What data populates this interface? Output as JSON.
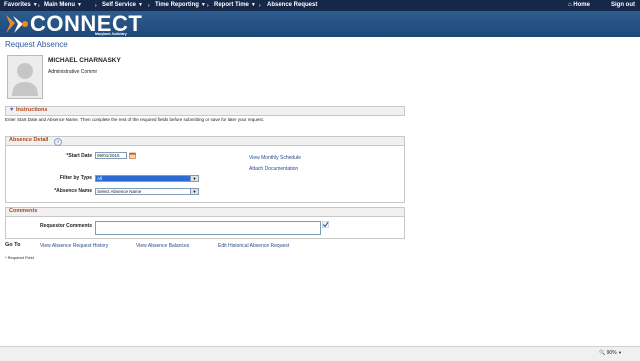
{
  "menubar": {
    "items": [
      "Favorites",
      "Main Menu",
      "Self Service",
      "Time Reporting",
      "Report Time",
      "Absence Request"
    ],
    "home": "Home",
    "signout": "Sign out"
  },
  "banner": {
    "logo_text": "CONNECT",
    "logo_sub": "Maryland Judiciary"
  },
  "page": {
    "title": "Request Absence"
  },
  "employee": {
    "name": "MICHAEL CHARNASKY",
    "title": "Administrative Commr"
  },
  "instructions": {
    "header": "Instructions",
    "text": "Enter Start Date and Absence Name. Then complete the rest of the required fields before submitting or save for later your request."
  },
  "absence_detail": {
    "header": "Absence Detail",
    "start_date_label": "*Start Date",
    "start_date_value": "09/01/2015",
    "filter_label": "Filter by Type",
    "filter_value": "All",
    "absence_name_label": "*Absence Name",
    "absence_name_value": "Select Absence Name",
    "view_schedule": "View Monthly Schedule",
    "attach_doc": "Attach Documentation"
  },
  "comments": {
    "header": "Comments",
    "requestor_label": "Requestor Comments",
    "requestor_value": ""
  },
  "goto": {
    "label": "Go To",
    "links": [
      "View Absence Request History",
      "View Absence Balances",
      "Edit Historical Absence Request"
    ]
  },
  "required_note": "* Required Field",
  "statusbar": {
    "zoom": "90%"
  }
}
